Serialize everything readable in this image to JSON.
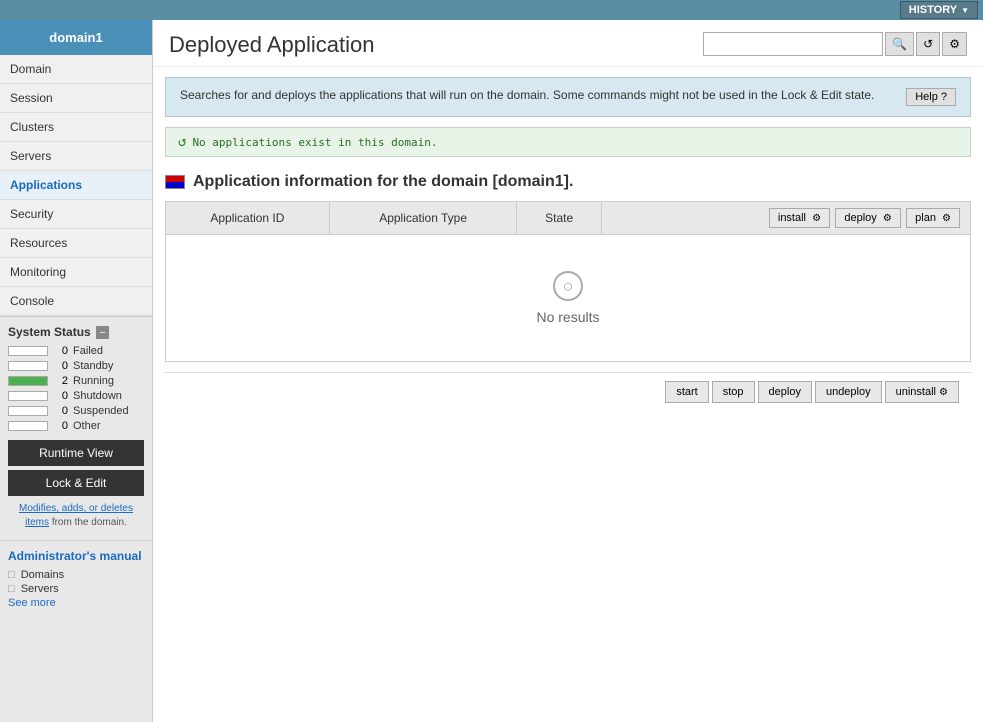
{
  "topBar": {
    "historyLabel": "HISTORY"
  },
  "sidebar": {
    "domainTitle": "domain1",
    "navItems": [
      {
        "label": "Domain",
        "active": false
      },
      {
        "label": "Session",
        "active": false
      },
      {
        "label": "Clusters",
        "active": false
      },
      {
        "label": "Servers",
        "active": false
      },
      {
        "label": "Applications",
        "active": true
      },
      {
        "label": "Security",
        "active": false
      },
      {
        "label": "Resources",
        "active": false
      },
      {
        "label": "Monitoring",
        "active": false
      },
      {
        "label": "Console",
        "active": false
      }
    ],
    "systemStatus": {
      "title": "System Status",
      "rows": [
        {
          "count": "0",
          "label": "Failed",
          "barPercent": 0,
          "type": ""
        },
        {
          "count": "0",
          "label": "Standby",
          "barPercent": 0,
          "type": ""
        },
        {
          "count": "2",
          "label": "Running",
          "barPercent": 100,
          "type": "running"
        },
        {
          "count": "0",
          "label": "Shutdown",
          "barPercent": 0,
          "type": ""
        },
        {
          "count": "0",
          "label": "Suspended",
          "barPercent": 0,
          "type": ""
        },
        {
          "count": "0",
          "label": "Other",
          "barPercent": 0,
          "type": ""
        }
      ]
    },
    "runtimeViewBtn": "Runtime View",
    "lockEditBtn": "Lock & Edit",
    "noteLink": "Modifies, adds, or deletes items",
    "noteText": " from the domain.",
    "adminManual": {
      "title": "Administrator's manual",
      "links": [
        {
          "label": "Domains",
          "icon": "□"
        },
        {
          "label": "Servers",
          "icon": "□",
          "seeMore": "See more"
        }
      ]
    }
  },
  "content": {
    "pageTitle": "Deployed Application",
    "searchPlaceholder": "",
    "infoBoxText": "Searches for and deploys the applications that will run on the domain. Some commands might not be used in the Lock & Edit state.",
    "helpLabel": "Help ?",
    "noAppsMessage": "No applications exist in this domain.",
    "appInfoTitle": "Application information for the domain [domain1].",
    "tableHeaders": {
      "appId": "Application ID",
      "appType": "Application Type",
      "state": "State"
    },
    "tableActions": {
      "install": "install",
      "deploy": "deploy",
      "plan": "plan"
    },
    "noResults": "No results",
    "bottomActions": {
      "start": "start",
      "stop": "stop",
      "deploy": "deploy",
      "undeploy": "undeploy",
      "uninstall": "uninstall"
    }
  }
}
